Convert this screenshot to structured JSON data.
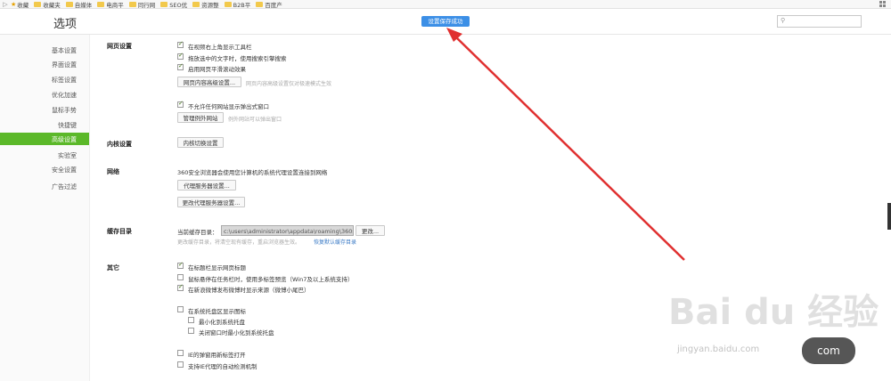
{
  "bookmarks": [
    "收藏",
    "收藏夹",
    "自媒体",
    "电商平",
    "同行网",
    "SEO优",
    "资源整",
    "B2B平",
    "百度产"
  ],
  "header": {
    "title": "选项",
    "toast": "设置保存成功"
  },
  "sidebar": {
    "items": [
      "基本设置",
      "界面设置",
      "标签设置",
      "优化加速",
      "鼠标手势",
      "快捷键",
      "高级设置",
      "实验室",
      "安全设置",
      "广告过滤"
    ],
    "active": "高级设置"
  },
  "webpage": {
    "label": "网页设置",
    "opt1": "在视频右上角显示工具栏",
    "opt2": "拖放选中的文字时，使用搜索引擎搜索",
    "opt3": "启用网页平滑滚动效果",
    "advanced_btn": "网页内容高级设置...",
    "advanced_hint": "网页内容高级设置仅对极速模式生效",
    "popup_opt": "不允许任何网站显示弹出式窗口",
    "exception_btn": "管理例外网站",
    "exception_hint": "例外网站可以弹出窗口"
  },
  "kernel": {
    "label": "内核设置",
    "btn": "内核切换设置"
  },
  "network": {
    "label": "网络",
    "desc": "360安全浏览器会使用您计算机的系统代理设置连接到网络",
    "proxy_btn": "代理服务器设置...",
    "change_proxy_btn": "更改代理服务器设置..."
  },
  "cache": {
    "label": "缓存目录",
    "current_label": "当前缓存目录：",
    "path": "c:\\users\\administrator\\appdata\\roaming\\360se6\\",
    "change_btn": "更改...",
    "note": "更改缓存目录，将清空现有缓存，重启浏览器生效。",
    "restore_link": "恢复默认缓存目录"
  },
  "other": {
    "label": "其它",
    "opt1": "在标题栏显示网页标题",
    "opt2": "鼠标悬停在任务栏时，使用多标签预览（Win7及以上系统支持）",
    "opt3": "在新浪微博发布微博时显示来源（微博小尾巴）",
    "tray": "在系统托盘区显示图标",
    "tray_sub1": "最小化到系统托盘",
    "tray_sub2": "关闭窗口时最小化到系统托盘",
    "ie_popup": "IE的弹窗用新标签打开",
    "proxy_detect": "支持IE代理的自动检测机制"
  },
  "watermark": {
    "logo": "Bai du 经验",
    "url": "jingyan.baidu.com",
    "bubble": "com"
  },
  "colors": {
    "accent_green": "#5bb829",
    "toast_blue": "#3c8fe6",
    "arrow_red": "#e03030"
  }
}
